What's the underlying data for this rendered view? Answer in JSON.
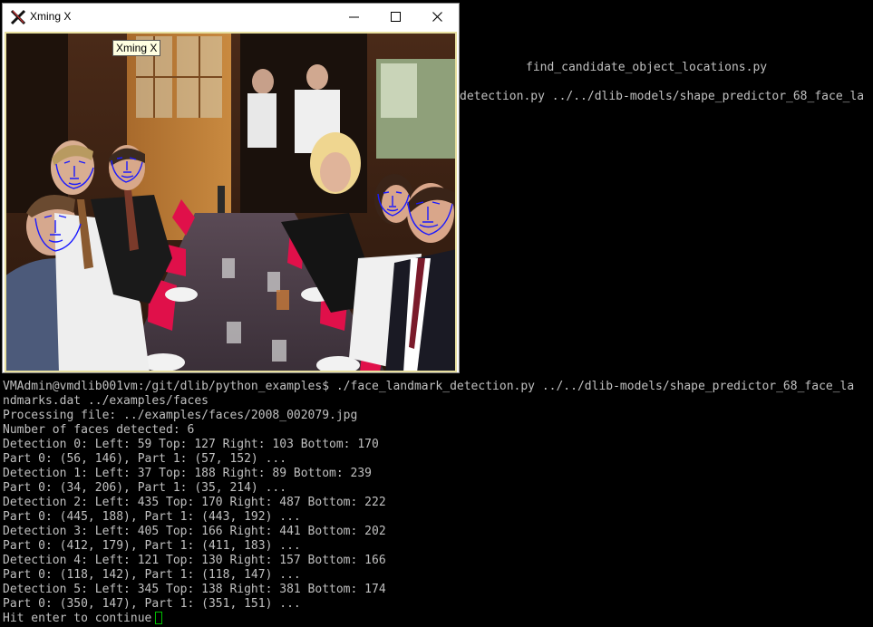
{
  "window": {
    "title": "Xming X",
    "tooltip": "Xming X",
    "controls": {
      "minimize": "minimize-icon",
      "maximize": "maximize-icon",
      "close": "close-icon"
    }
  },
  "terminal": {
    "partial_lines": {
      "line1": "find_candidate_object_locations.py",
      "line2": "detection.py ../../dlib-models/shape_predictor_68_face_la"
    },
    "lines": [
      "VMAdmin@vmdlib001vm:/git/dlib/python_examples$ ./face_landmark_detection.py ../../dlib-models/shape_predictor_68_face_la",
      "ndmarks.dat ../examples/faces",
      "Processing file: ../examples/faces/2008_002079.jpg",
      "Number of faces detected: 6",
      "Detection 0: Left: 59 Top: 127 Right: 103 Bottom: 170",
      "Part 0: (56, 146), Part 1: (57, 152) ...",
      "Detection 1: Left: 37 Top: 188 Right: 89 Bottom: 239",
      "Part 0: (34, 206), Part 1: (35, 214) ...",
      "Detection 2: Left: 435 Top: 170 Right: 487 Bottom: 222",
      "Part 0: (445, 188), Part 1: (443, 192) ...",
      "Detection 3: Left: 405 Top: 166 Right: 441 Bottom: 202",
      "Part 0: (412, 179), Part 1: (411, 183) ...",
      "Detection 4: Left: 121 Top: 130 Right: 157 Bottom: 166",
      "Part 0: (118, 142), Part 1: (118, 147) ...",
      "Detection 5: Left: 345 Top: 138 Right: 381 Bottom: 174",
      "Part 0: (350, 147), Part 1: (351, 151) ...",
      "Hit enter to continue"
    ]
  },
  "colors": {
    "terminal_bg": "#000000",
    "terminal_fg": "#c0c0c0",
    "cursor": "#00c000",
    "landmark": "#1a1aff"
  }
}
